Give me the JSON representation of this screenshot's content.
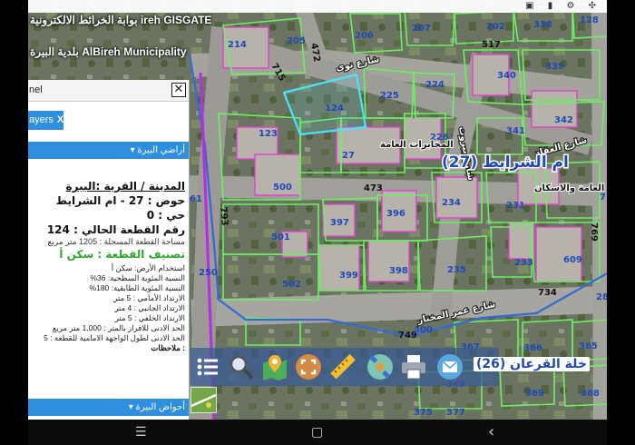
{
  "app": {
    "title": "بوابة الخرائط الالكترونية ireh GISGATE",
    "municipality": "بلدية البيرة AlBireh Municipality",
    "status_icons": "▣ ▮ ⚙ ✣"
  },
  "panel": {
    "title": "nel",
    "close_glyph": "✕",
    "layers_tab": "ayers",
    "layers_close": "X",
    "accordion_1": "أراضي البيرة ▾",
    "accordion_2": "أحواض البيرة ▾",
    "info": {
      "city": "المدينة / القرية :البيرة",
      "basin": "حوض : 27 - ام الشرايط",
      "quarter": "حي : 0",
      "plot": "رقم القطعة الحالي : 124",
      "area": "مساحة القطعة المسجلة : 1205 متر مربع",
      "classification": "تصنيف القطعة : سكن أ",
      "land_use": "استخدام الأرض: سكن أ",
      "surface_ratio": "النسبة المئوية السطحية: 36%",
      "floor_ratio": "النسبة المئوية الطابقية: 180%",
      "front_setback": "الارتداد الأمامي : 5 متر",
      "side_setback": "الارتداد الجانبي : 4 متر",
      "back_setback": "الارتداد الخلفي : 5 متر",
      "min_area": "الحد الادنى للافراز بالمتر : 1,000 متر مربع",
      "min_frontage": "الحد الادنى لطول الواجهة الامامية للقطعة : 5",
      "notes": ": ملاحظات"
    }
  },
  "map": {
    "parcels": [
      "214",
      "205",
      "206",
      "207",
      "202",
      "338",
      "128",
      "517",
      "340",
      "339",
      "225",
      "224",
      "124",
      "342",
      "123",
      "226",
      "341",
      "27",
      "473",
      "234",
      "231",
      "500",
      "397",
      "396",
      "501",
      "609",
      "250",
      "233",
      "399",
      "398",
      "235",
      "502",
      "734",
      "749",
      "400",
      "367",
      "366",
      "365",
      "349",
      "369",
      "368",
      "377",
      "375",
      "61",
      "7",
      "28"
    ],
    "streets": [
      "شارع نوى",
      "شارع العقاد",
      "شارع عمر المختار",
      "شارع بيروت"
    ],
    "roads": [
      "472",
      "715",
      "793",
      "769"
    ],
    "block_label": "ام الشرايط (27)",
    "poi_1": "المخابرات العامة",
    "poi_2": "وزارة الاشغال العامة والاسكان",
    "neighborhood": "خلة القرعان (26)",
    "colors": {
      "parcel": "#6cf061",
      "highlight": "#48e3ff",
      "building": "#e040d0",
      "road_blue": "#3469d8",
      "road_purple": "#b531e0"
    }
  },
  "toolbar": {
    "tools": [
      "list-icon",
      "search-icon",
      "map-pin-icon",
      "extent-icon",
      "ruler-icon",
      "satellite-icon",
      "print-icon",
      "mail-icon"
    ]
  },
  "navbar": {
    "menu": "☰",
    "home": "▢",
    "back": "‹"
  }
}
